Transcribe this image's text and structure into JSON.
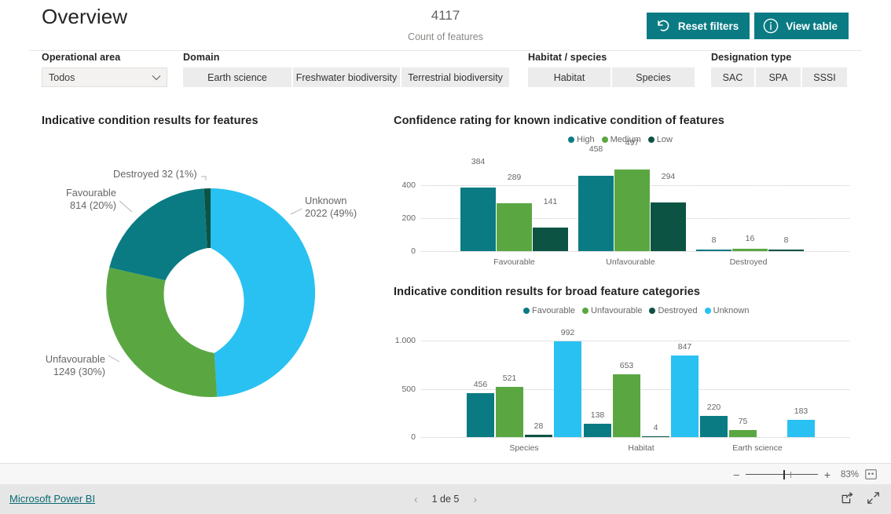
{
  "header": {
    "title": "Overview",
    "kpi_value": "4117",
    "kpi_label": "Count of features",
    "reset_filters_label": "Reset filters",
    "view_table_label": "View table"
  },
  "filters": {
    "operational_area": {
      "label": "Operational area",
      "selected": "Todos"
    },
    "domain": {
      "label": "Domain",
      "options": [
        "Earth science",
        "Freshwater biodiversity",
        "Terrestrial biodiversity"
      ]
    },
    "habitat_species": {
      "label": "Habitat / species",
      "options": [
        "Habitat",
        "Species"
      ]
    },
    "designation_type": {
      "label": "Designation type",
      "options": [
        "SAC",
        "SPA",
        "SSSI"
      ]
    }
  },
  "panels": {
    "donut_title": "Indicative condition results for features",
    "confidence_title": "Confidence rating for known indicative condition of features",
    "broad_title": "Indicative condition results for broad feature categories"
  },
  "colors": {
    "teal": "#0a7b83",
    "green": "#5aa742",
    "dark_green": "#0d5344",
    "light_blue": "#29c1f2",
    "brand": "#0a7b83",
    "grid": "#c8c6c4",
    "text_muted": "#666666"
  },
  "chart_data": [
    {
      "type": "pie",
      "id": "donut-condition",
      "title": "Indicative condition results for features",
      "total": 4117,
      "slices": [
        {
          "label": "Unknown",
          "value": 2022,
          "percent": "49%",
          "color": "#29c1f2",
          "display": "Unknown\n2022 (49%)"
        },
        {
          "label": "Unfavourable",
          "value": 1249,
          "percent": "30%",
          "color": "#5aa742",
          "display": "Unfavourable\n1249 (30%)"
        },
        {
          "label": "Favourable",
          "value": 814,
          "percent": "20%",
          "color": "#0a7b83",
          "display": "Favourable\n814 (20%)"
        },
        {
          "label": "Destroyed",
          "value": 32,
          "percent": "1%",
          "color": "#0d5344",
          "display": "Destroyed 32 (1%)"
        }
      ],
      "labels": {
        "destroyed": {
          "line1": "Destroyed 32 (1%)"
        },
        "favourable": {
          "line1": "Favourable",
          "line2": "814 (20%)"
        },
        "unknown": {
          "line1": "Unknown",
          "line2": "2022 (49%)"
        },
        "unfavourable": {
          "line1": "Unfavourable",
          "line2": "1249 (30%)"
        }
      }
    },
    {
      "type": "bar",
      "id": "confidence-rating",
      "title": "Confidence rating for known indicative condition of features",
      "categories": [
        "Favourable",
        "Unfavourable",
        "Destroyed"
      ],
      "series": [
        {
          "name": "High",
          "color": "#0a7b83",
          "values": [
            384,
            458,
            8
          ]
        },
        {
          "name": "Medium",
          "color": "#5aa742",
          "values": [
            289,
            497,
            16
          ]
        },
        {
          "name": "Low",
          "color": "#0d5344",
          "values": [
            141,
            294,
            8
          ]
        }
      ],
      "yticks": [
        "0",
        "200",
        "400"
      ],
      "ytick_values": [
        0,
        200,
        400
      ],
      "ylim": [
        0,
        480
      ],
      "grid": true,
      "legend_position": "top"
    },
    {
      "type": "bar",
      "id": "broad-feature-categories",
      "title": "Indicative condition results for broad feature categories",
      "categories": [
        "Species",
        "Habitat",
        "Earth science"
      ],
      "series": [
        {
          "name": "Favourable",
          "color": "#0a7b83",
          "values": [
            456,
            138,
            220
          ]
        },
        {
          "name": "Unfavourable",
          "color": "#5aa742",
          "values": [
            521,
            653,
            75
          ]
        },
        {
          "name": "Destroyed",
          "color": "#0d5344",
          "values": [
            28,
            4,
            0
          ]
        },
        {
          "name": "Unknown",
          "color": "#29c1f2",
          "values": [
            992,
            847,
            183
          ]
        }
      ],
      "yticks": [
        "0",
        "500",
        "1.000"
      ],
      "ytick_values": [
        0,
        500,
        1000
      ],
      "ylim": [
        0,
        1000
      ],
      "grid": true,
      "legend_position": "top"
    }
  ],
  "footer": {
    "powerbi_link": "Microsoft Power BI",
    "page_indicator": "1 de 5",
    "zoom_percent": "83%"
  }
}
